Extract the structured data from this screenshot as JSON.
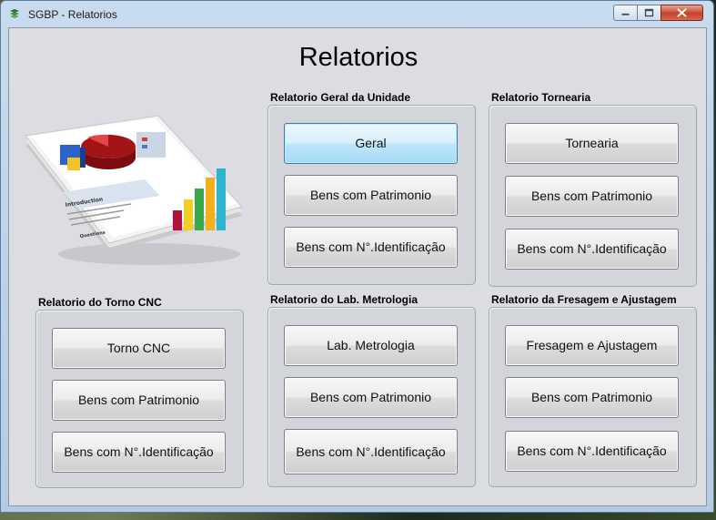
{
  "window": {
    "title": "SGBP - Relatorios"
  },
  "main": {
    "heading": "Relatorios"
  },
  "groups": [
    {
      "title": "Relatorio Geral da Unidade",
      "buttons": [
        "Geral",
        "Bens com Patrimonio",
        "Bens com N°.Identificação"
      ]
    },
    {
      "title": "Relatorio Tornearia",
      "buttons": [
        "Tornearia",
        "Bens com Patrimonio",
        "Bens com N°.Identificação"
      ]
    },
    {
      "title": "Relatorio do Torno CNC",
      "buttons": [
        "Torno CNC",
        "Bens com Patrimonio",
        "Bens com N°.Identificação"
      ]
    },
    {
      "title": "Relatorio do Lab. Metrologia",
      "buttons": [
        "Lab. Metrologia",
        "Bens com Patrimonio",
        "Bens com N°.Identificação"
      ]
    },
    {
      "title": "Relatorio da Fresagem e Ajustagem",
      "buttons": [
        "Fresagem e Ajustagem",
        "Bens com Patrimonio",
        "Bens com N°.Identificação"
      ]
    }
  ],
  "illustration": {
    "icon": "report-document-icon",
    "heading": "Introduction",
    "subheading": "Questions"
  },
  "colors": {
    "focused_button": "#bee6fd",
    "close_button": "#c2432a"
  }
}
